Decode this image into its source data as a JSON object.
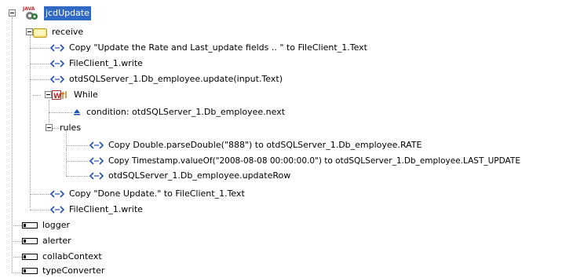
{
  "tree": {
    "root": {
      "label": "jcdUpdate",
      "icon": "java-collab-icon",
      "icon_text": "JAVA"
    },
    "receive": {
      "label": "receive",
      "icon": "folder-icon"
    },
    "copy_update_text": {
      "label": "Copy \"Update the Rate and Last_update fields .. \" to FileClient_1.Text",
      "icon": "method-arrow-icon"
    },
    "write_1": {
      "label": "FileClient_1.write",
      "icon": "method-arrow-icon"
    },
    "sql_update": {
      "label": "otdSQLServer_1.Db_employee.update(input.Text)",
      "icon": "method-arrow-icon"
    },
    "while": {
      "label": "While",
      "icon": "while-loop-icon"
    },
    "condition": {
      "label": "condition: otdSQLServer_1.Db_employee.next",
      "icon": "condition-icon"
    },
    "rules": {
      "label": "rules"
    },
    "copy_rate": {
      "label": "Copy Double.parseDouble(\"888\") to otdSQLServer_1.Db_employee.RATE",
      "icon": "method-arrow-icon"
    },
    "copy_timestamp": {
      "label": "Copy Timestamp.valueOf(\"2008-08-08 00:00:00.0\") to otdSQLServer_1.Db_employee.LAST_UPDATE",
      "icon": "method-arrow-icon"
    },
    "update_row": {
      "label": "otdSQLServer_1.Db_employee.updateRow",
      "icon": "method-arrow-icon"
    },
    "copy_done": {
      "label": "Copy \"Done Update.\" to FileClient_1.Text",
      "icon": "method-arrow-icon"
    },
    "write_2": {
      "label": "FileClient_1.write",
      "icon": "method-arrow-icon"
    },
    "logger": {
      "label": "logger",
      "icon": "variable-icon"
    },
    "alerter": {
      "label": "alerter",
      "icon": "variable-icon"
    },
    "collabContext": {
      "label": "collabContext",
      "icon": "variable-icon"
    },
    "typeConverter": {
      "label": "typeConverter",
      "icon": "variable-icon"
    }
  },
  "colors": {
    "selection_bg": "#316ac5",
    "selection_text": "#ffffff",
    "method_icon": "#1f4fb0",
    "folder_fill": "#f7e27a",
    "java_text": "#c0282c"
  }
}
